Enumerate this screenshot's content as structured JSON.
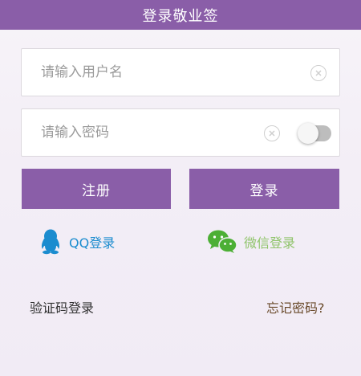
{
  "header": {
    "title": "登录敬业签"
  },
  "form": {
    "username": {
      "placeholder": "请输入用户名",
      "value": ""
    },
    "password": {
      "placeholder": "请输入密码",
      "value": ""
    }
  },
  "buttons": {
    "register": "注册",
    "login": "登录"
  },
  "social": {
    "qq": {
      "label": "QQ登录",
      "icon": "qq-penguin-icon",
      "color": "#1b8ccf"
    },
    "wechat": {
      "label": "微信登录",
      "icon": "wechat-icon",
      "color": "#8fc46a"
    }
  },
  "links": {
    "sms_login": "验证码登录",
    "forgot_password": "忘记密码?"
  },
  "colors": {
    "accent": "#8a5ea8",
    "forgot_link": "#6b4b2c",
    "sms_link": "#333333"
  }
}
